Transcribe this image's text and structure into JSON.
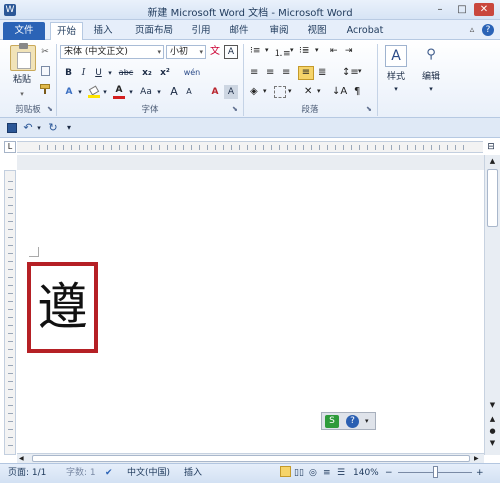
{
  "window": {
    "title": "新建 Microsoft Word 文档 - Microsoft Word",
    "controls": [
      "–",
      "□",
      "✕"
    ]
  },
  "tabs": [
    {
      "label": "文件",
      "active": false
    },
    {
      "label": "开始",
      "active": true
    },
    {
      "label": "插入"
    },
    {
      "label": "页面布局"
    },
    {
      "label": "引用"
    },
    {
      "label": "邮件"
    },
    {
      "label": "审阅"
    },
    {
      "label": "视图"
    },
    {
      "label": "Acrobat"
    }
  ],
  "clipboard": {
    "paste_label": "粘贴",
    "group_label": "剪贴板"
  },
  "font": {
    "family_value": "宋体 (中文正文)",
    "size_value": "小初",
    "group_label": "字体",
    "bold": "B",
    "italic": "I",
    "underline": "U",
    "strike": "abc",
    "subscript": "x₂",
    "superscript": "x²",
    "grow": "A",
    "shrink": "A",
    "case": "Aa",
    "clear": "A",
    "color": "A",
    "wen": "文",
    "wen2": "A",
    "phonetic": "wén"
  },
  "paragraph": {
    "group_label": "段落"
  },
  "styles": {
    "label": "样式"
  },
  "editing": {
    "label": "编辑"
  },
  "document": {
    "character": "遵"
  },
  "statusbar": {
    "page": "页面: 1/1",
    "words": "字数: 1",
    "language": "中文(中国)",
    "mode": "插入",
    "zoom": "140%"
  },
  "colors": {
    "file_tab": "#2b63b6",
    "border_red": "#b52025",
    "ribbon_bg": "#e9f0fa"
  }
}
